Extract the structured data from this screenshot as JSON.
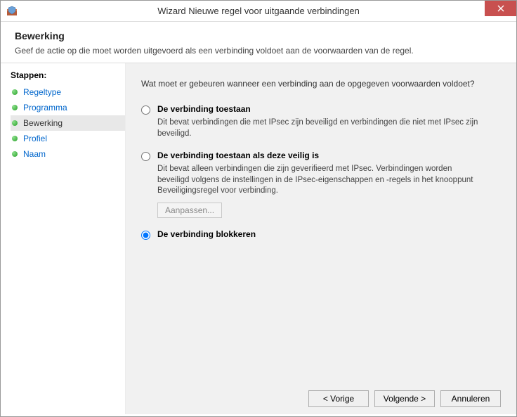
{
  "titlebar": {
    "title": "Wizard Nieuwe regel voor uitgaande verbindingen"
  },
  "header": {
    "title": "Bewerking",
    "description": "Geef de actie op die moet worden uitgevoerd als een verbinding voldoet aan de voorwaarden van de regel."
  },
  "sidebar": {
    "title": "Stappen:",
    "steps": [
      {
        "label": "Regeltype"
      },
      {
        "label": "Programma"
      },
      {
        "label": "Bewerking"
      },
      {
        "label": "Profiel"
      },
      {
        "label": "Naam"
      }
    ],
    "current_index": 2
  },
  "main": {
    "question": "Wat moet er gebeuren wanneer een verbinding aan de opgegeven voorwaarden voldoet?",
    "options": [
      {
        "title": "De verbinding toestaan",
        "description": "Dit bevat verbindingen die met IPsec zijn beveiligd en verbindingen die niet met IPsec zijn beveiligd."
      },
      {
        "title": "De verbinding toestaan als deze veilig is",
        "description": "Dit bevat alleen verbindingen die zijn geverifieerd met IPsec. Verbindingen worden beveiligd volgens de instellingen in de IPsec-eigenschappen en -regels in het knooppunt Beveiligingsregel voor verbinding.",
        "customize_label": "Aanpassen..."
      },
      {
        "title": "De verbinding blokkeren"
      }
    ],
    "selected_index": 2
  },
  "footer": {
    "back": "< Vorige",
    "next": "Volgende >",
    "cancel": "Annuleren"
  }
}
